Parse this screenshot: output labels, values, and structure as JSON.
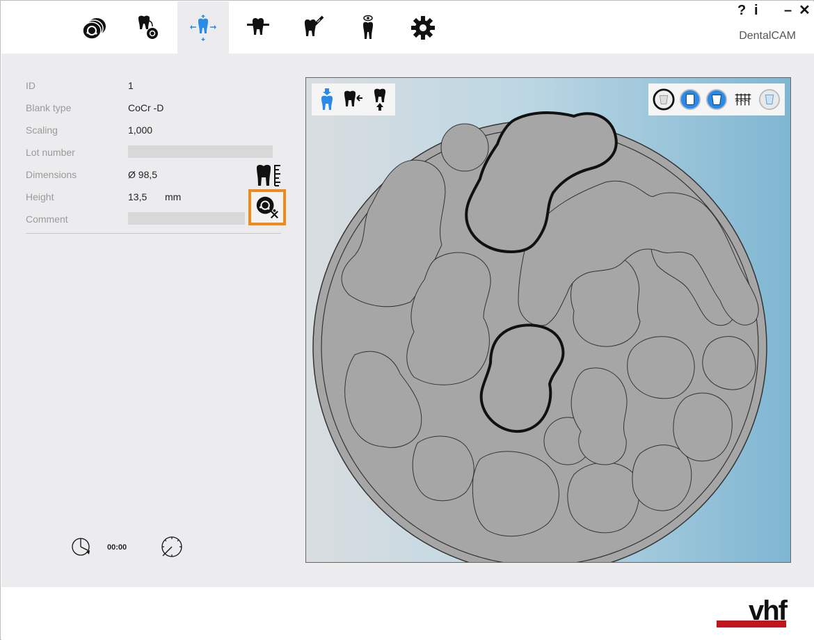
{
  "app": {
    "name": "DentalCAM"
  },
  "window": {
    "help": "?",
    "info": "i",
    "minimize": "–",
    "close": "✕"
  },
  "tabs": [
    {
      "name": "blank-tab",
      "icon": "blank-disc-icon",
      "active": false
    },
    {
      "name": "job-tab",
      "icon": "tooth-add-icon",
      "active": false
    },
    {
      "name": "nesting-tab",
      "icon": "tooth-move-icon",
      "active": true
    },
    {
      "name": "support-tab",
      "icon": "tooth-support-icon",
      "active": false
    },
    {
      "name": "calculation-tab",
      "icon": "tooth-tool-icon",
      "active": false
    },
    {
      "name": "preview-tab",
      "icon": "tooth-view-icon",
      "active": false
    },
    {
      "name": "settings-tab",
      "icon": "gear-icon",
      "active": false
    }
  ],
  "blank_info": {
    "id_label": "ID",
    "id_value": "1",
    "type_label": "Blank type",
    "type_value": "CoCr -D",
    "scaling_label": "Scaling",
    "scaling_value": "1,000",
    "lot_label": "Lot number",
    "lot_value": "",
    "dimensions_label": "Dimensions",
    "dimensions_value": "Ø 98,5",
    "height_label": "Height",
    "height_value": "13,5",
    "height_unit": "mm",
    "comment_label": "Comment",
    "comment_value": ""
  },
  "timer": {
    "value": "00:00"
  },
  "colors": {
    "accent": "#2a8ae8",
    "highlight": "#f08a1c",
    "brand_red": "#c2141f"
  },
  "logo": {
    "text": "vhf"
  }
}
